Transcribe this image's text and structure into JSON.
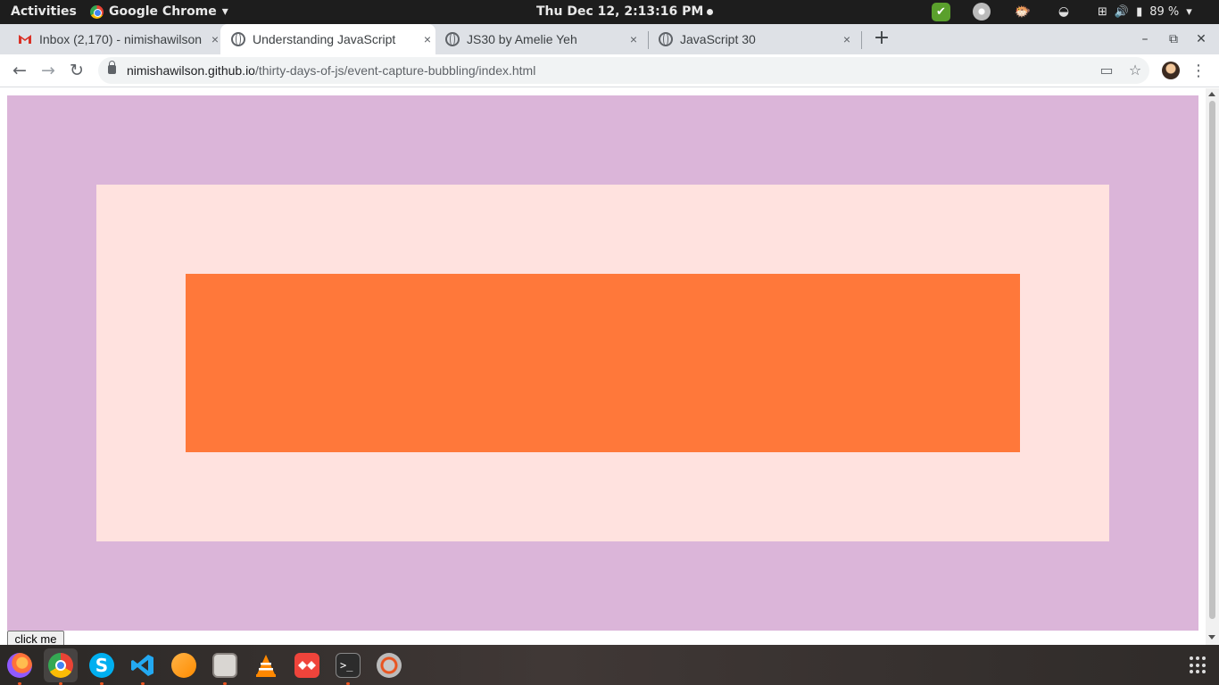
{
  "topbar": {
    "activities": "Activities",
    "app_name": "Google Chrome",
    "app_menu_arrow": "▾",
    "clock": "Thu Dec 12,  2:13:16 PM",
    "battery": "89 %",
    "system_arrow": "▾"
  },
  "tabs": [
    {
      "title": "Inbox (2,170) - nimishawilson",
      "favicon": "gmail-icon",
      "active": false
    },
    {
      "title": "Understanding JavaScript",
      "favicon": "globe-icon",
      "active": true
    },
    {
      "title": "JS30 by Amelie Yeh",
      "favicon": "globe-icon",
      "active": false
    },
    {
      "title": "JavaScript 30",
      "favicon": "globe-icon",
      "active": false
    }
  ],
  "tab_close_glyph": "×",
  "new_tab_glyph": "+",
  "window_controls": {
    "minimize": "–",
    "restore": "⧉",
    "close": "✕"
  },
  "toolbar": {
    "back": "←",
    "forward": "→",
    "reload": "↻",
    "url_host": "nimishawilson.github.io",
    "url_path": "/thirty-days-of-js/event-capture-bubbling/index.html",
    "cast_glyph": "▭",
    "star_glyph": "☆",
    "menu_glyph": "⋮"
  },
  "page": {
    "button_label": "click me",
    "colors": {
      "outer": "#dbb5d9",
      "middle": "#ffe2df",
      "inner": "#ff783a"
    }
  },
  "dock": {
    "apps": [
      "firefox-icon",
      "chrome-icon",
      "skype-icon",
      "vscode-icon",
      "sublime-icon",
      "files-icon",
      "vlc-icon",
      "anydesk-icon",
      "terminal-icon",
      "software-updater-icon"
    ]
  }
}
